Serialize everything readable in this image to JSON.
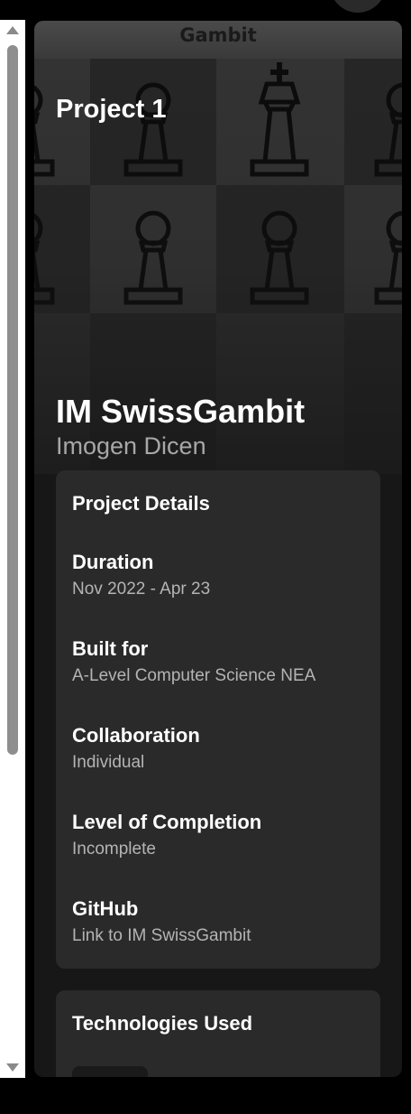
{
  "window": {
    "title": "Gambit"
  },
  "hero": {
    "project_label": "Project 1",
    "title": "IM SwissGambit",
    "subtitle": "Imogen Dicen"
  },
  "project_details": {
    "heading": "Project Details",
    "items": [
      {
        "label": "Duration",
        "value": "Nov 2022 - Apr 23"
      },
      {
        "label": "Built for",
        "value": "A-Level Computer Science NEA"
      },
      {
        "label": "Collaboration",
        "value": "Individual"
      },
      {
        "label": "Level of Completion",
        "value": "Incomplete"
      },
      {
        "label": "GitHub",
        "value": "Link to IM SwissGambit"
      }
    ]
  },
  "technologies": {
    "heading": "Technologies Used"
  },
  "colors": {
    "background": "#000000",
    "window_bg": "#171717",
    "card_bg": "#2a2a2a",
    "text_primary": "#ffffff",
    "text_secondary": "#b4b4b4"
  }
}
